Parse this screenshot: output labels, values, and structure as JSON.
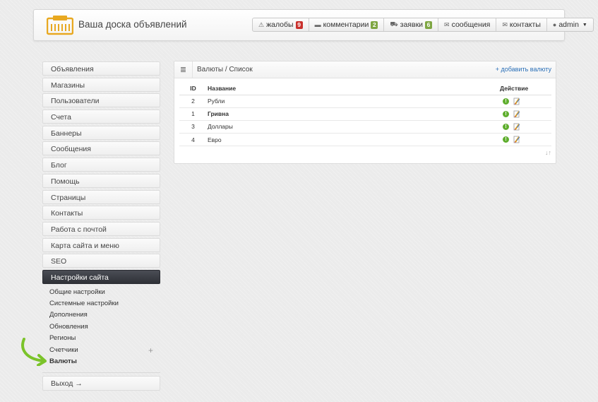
{
  "header": {
    "site_title": "Ваша доска объявлений",
    "nav": [
      {
        "label": "жалобы",
        "icon": "⚠",
        "badge": "9",
        "badge_color": "#c9302c"
      },
      {
        "label": "комментарии",
        "icon": "💬",
        "badge": "2",
        "badge_color": "#7ea642"
      },
      {
        "label": "заявки",
        "icon": "🛒",
        "badge": "6",
        "badge_color": "#7ea642"
      },
      {
        "label": "сообщения",
        "icon": "✉"
      },
      {
        "label": "контакты",
        "icon": "✉"
      },
      {
        "label": "admin",
        "icon": "👤"
      }
    ]
  },
  "sidebar": {
    "items": [
      {
        "label": "Объявления"
      },
      {
        "label": "Магазины"
      },
      {
        "label": "Пользователи"
      },
      {
        "label": "Счета"
      },
      {
        "label": "Баннеры"
      },
      {
        "label": "Сообщения"
      },
      {
        "label": "Блог"
      },
      {
        "label": "Помощь"
      },
      {
        "label": "Страницы"
      },
      {
        "label": "Контакты"
      },
      {
        "label": "Работа с почтой"
      },
      {
        "label": "Карта сайта и меню"
      },
      {
        "label": "SEO"
      },
      {
        "label": "Настройки сайта"
      }
    ],
    "sub_items": [
      {
        "label": "Общие настройки"
      },
      {
        "label": "Системные настройки"
      },
      {
        "label": "Дополнения"
      },
      {
        "label": "Обновления"
      },
      {
        "label": "Регионы"
      },
      {
        "label": "Счетчики"
      },
      {
        "label": "Валюты"
      }
    ],
    "exit_label": "Выход →"
  },
  "main": {
    "title": "Валюты / Список",
    "add_link": "+ добавить валюту",
    "columns": [
      "ID",
      "Название",
      "Действие"
    ],
    "rows": [
      {
        "id": "2",
        "name": "Рубли"
      },
      {
        "id": "1",
        "name": "Гривна"
      },
      {
        "id": "3",
        "name": "Доллары"
      },
      {
        "id": "4",
        "name": "Евро"
      }
    ],
    "sort_icon": "↓↑"
  },
  "colors": {
    "accent": "#2a6fb7",
    "active_bg": "#3a3c42",
    "status_green": "#5fae2e"
  }
}
